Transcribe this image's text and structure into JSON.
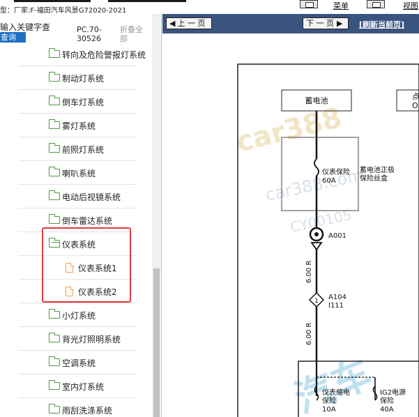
{
  "topbar": {
    "model_label": "型：厂家:F-福田汽车风景G72020-2021",
    "menu_label": "菜单",
    "view_label": "视图"
  },
  "left_panel": {
    "search_placeholder": "输入关键字查",
    "query_label": "查询",
    "pc_label_line1": "PC.70-",
    "pc_label_line2": "30526",
    "collapse_all_line1": "折叠全",
    "collapse_all_line2": "部",
    "tree_items": [
      {
        "label": "转向及危险警报灯系统",
        "type": "folder"
      },
      {
        "label": "制动灯系统",
        "type": "folder"
      },
      {
        "label": "倒车灯系统",
        "type": "folder"
      },
      {
        "label": "雾灯系统",
        "type": "folder"
      },
      {
        "label": "前照灯系统",
        "type": "folder"
      },
      {
        "label": "喇叭系统",
        "type": "folder"
      },
      {
        "label": "电动后视镜系统",
        "type": "folder"
      },
      {
        "label": "倒车雷达系统",
        "type": "folder"
      },
      {
        "label": "仪表系统",
        "type": "folder-open"
      },
      {
        "label": "仪表系统1",
        "type": "file"
      },
      {
        "label": "仪表系统2",
        "type": "file"
      },
      {
        "label": "小灯系统",
        "type": "folder"
      },
      {
        "label": "背光灯照明系统",
        "type": "folder"
      },
      {
        "label": "空调系统",
        "type": "folder"
      },
      {
        "label": "室内灯系统",
        "type": "folder"
      },
      {
        "label": "雨刮洗涤系统",
        "type": "folder"
      }
    ]
  },
  "right_panel": {
    "prev_page_label": "上 一 页",
    "next_page_label": "下 一 页",
    "refresh_label": "[刷新当前页]",
    "diagram": {
      "battery_label": "蓄电池",
      "right_box_label_1": "点",
      "right_box_label_2": "O",
      "fuse1_label_1": "仪表保险",
      "fuse1_label_2": "60A",
      "fuse_box_label_1": "蓄电池正极",
      "fuse_box_label_2": "保险丝盒",
      "connector1": "A001",
      "wire1": "6.00 R",
      "connector2_1": "A104",
      "connector2_2": "I111",
      "connector2_num": "1",
      "wire2": "6.00 R",
      "fuse2_label_1": "仪表缩电",
      "fuse2_label_2": "保险",
      "fuse2_label_3": "10A",
      "fuse3_label_1": "IG2电源",
      "fuse3_label_2": "保险",
      "fuse3_label_3": "40A",
      "watermark_1": "car388",
      "watermark_2": "car388.com",
      "watermark_3": "CY00105",
      "watermark_4": "汽车"
    }
  },
  "colors": {
    "nav_blue": "#3a5480",
    "query_blue": "#1e6fc4",
    "highlight_red": "#e23b3b",
    "folder_green": "#4a9a3a",
    "file_orange": "#e8a050"
  }
}
